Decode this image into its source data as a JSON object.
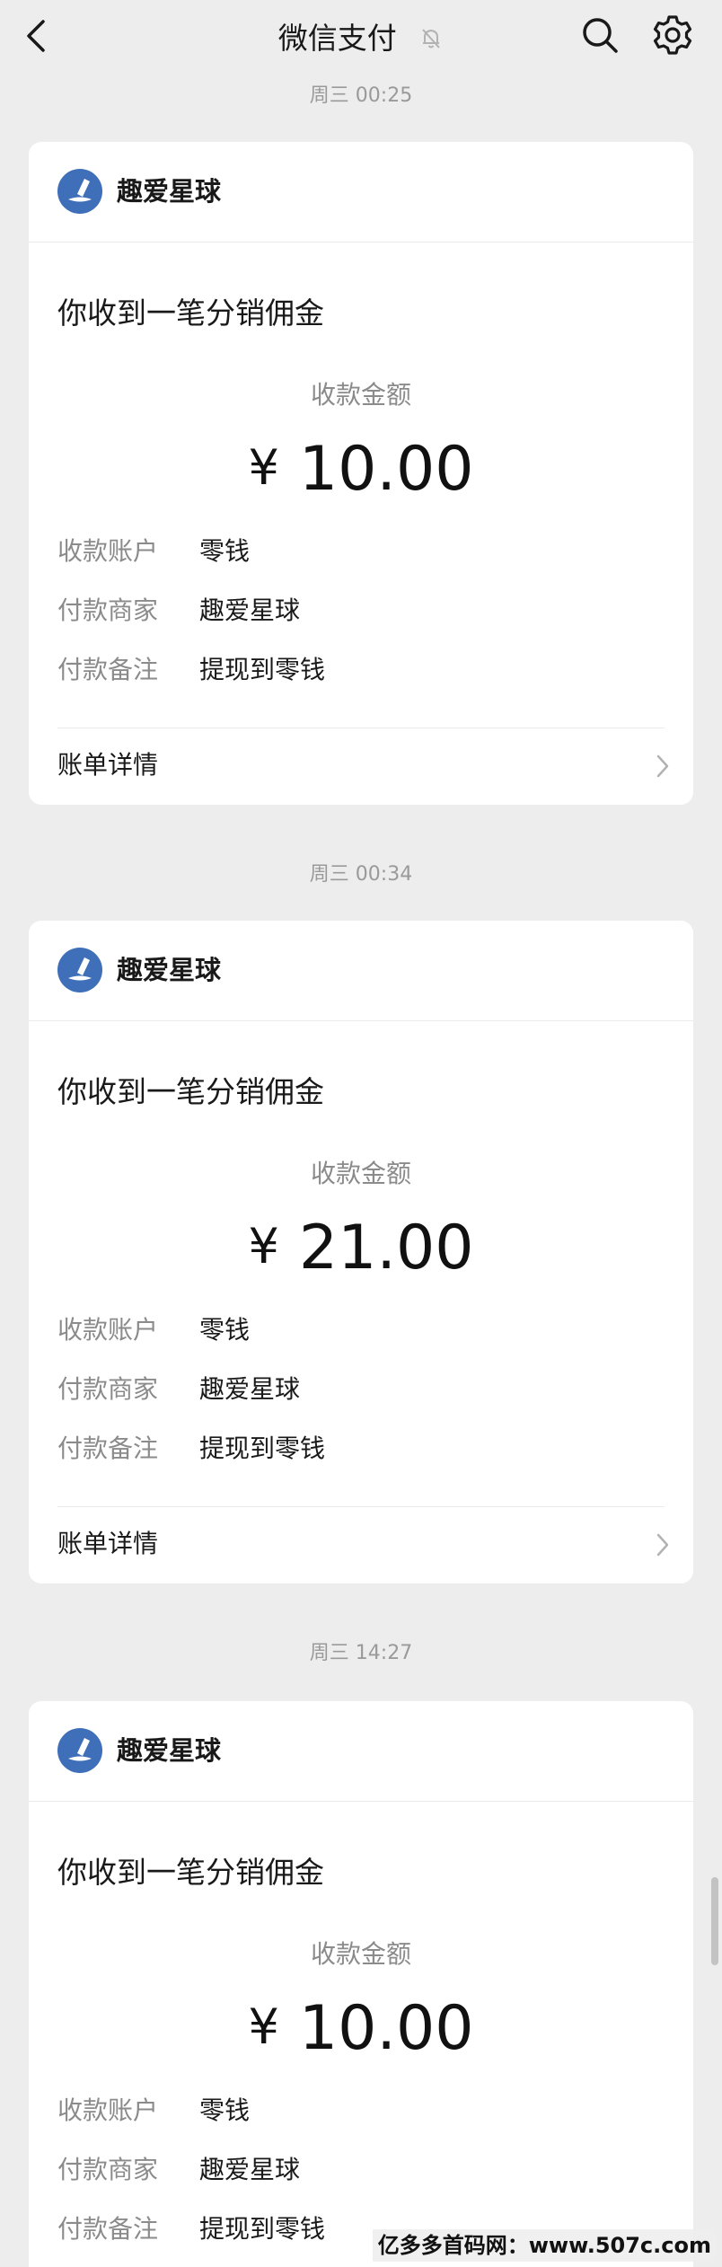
{
  "header": {
    "title": "微信支付",
    "icons": {
      "back": "chevron-left-icon",
      "mute": "bell-off-icon",
      "search": "search-icon",
      "settings": "gear-icon"
    }
  },
  "colors": {
    "background": "#ededed",
    "card": "#ffffff",
    "logo": "#3f6fb8",
    "muted_text": "#8b8b8b"
  },
  "messages": [
    {
      "time": "周三 00:25",
      "merchant": "趣爱星球",
      "title": "你收到一笔分销佣金",
      "amount_label": "收款金额",
      "currency": "¥",
      "amount": "10.00",
      "fields": [
        {
          "key": "收款账户",
          "value": "零钱"
        },
        {
          "key": "付款商家",
          "value": "趣爱星球"
        },
        {
          "key": "付款备注",
          "value": "提现到零钱"
        }
      ],
      "detail_label": "账单详情"
    },
    {
      "time": "周三 00:34",
      "merchant": "趣爱星球",
      "title": "你收到一笔分销佣金",
      "amount_label": "收款金额",
      "currency": "¥",
      "amount": "21.00",
      "fields": [
        {
          "key": "收款账户",
          "value": "零钱"
        },
        {
          "key": "付款商家",
          "value": "趣爱星球"
        },
        {
          "key": "付款备注",
          "value": "提现到零钱"
        }
      ],
      "detail_label": "账单详情"
    },
    {
      "time": "周三 14:27",
      "merchant": "趣爱星球",
      "title": "你收到一笔分销佣金",
      "amount_label": "收款金额",
      "currency": "¥",
      "amount": "10.00",
      "fields": [
        {
          "key": "收款账户",
          "value": "零钱"
        },
        {
          "key": "付款商家",
          "value": "趣爱星球"
        },
        {
          "key": "付款备注",
          "value": "提现到零钱"
        }
      ]
    }
  ],
  "watermark": "亿多多首码网：www.507c.com"
}
